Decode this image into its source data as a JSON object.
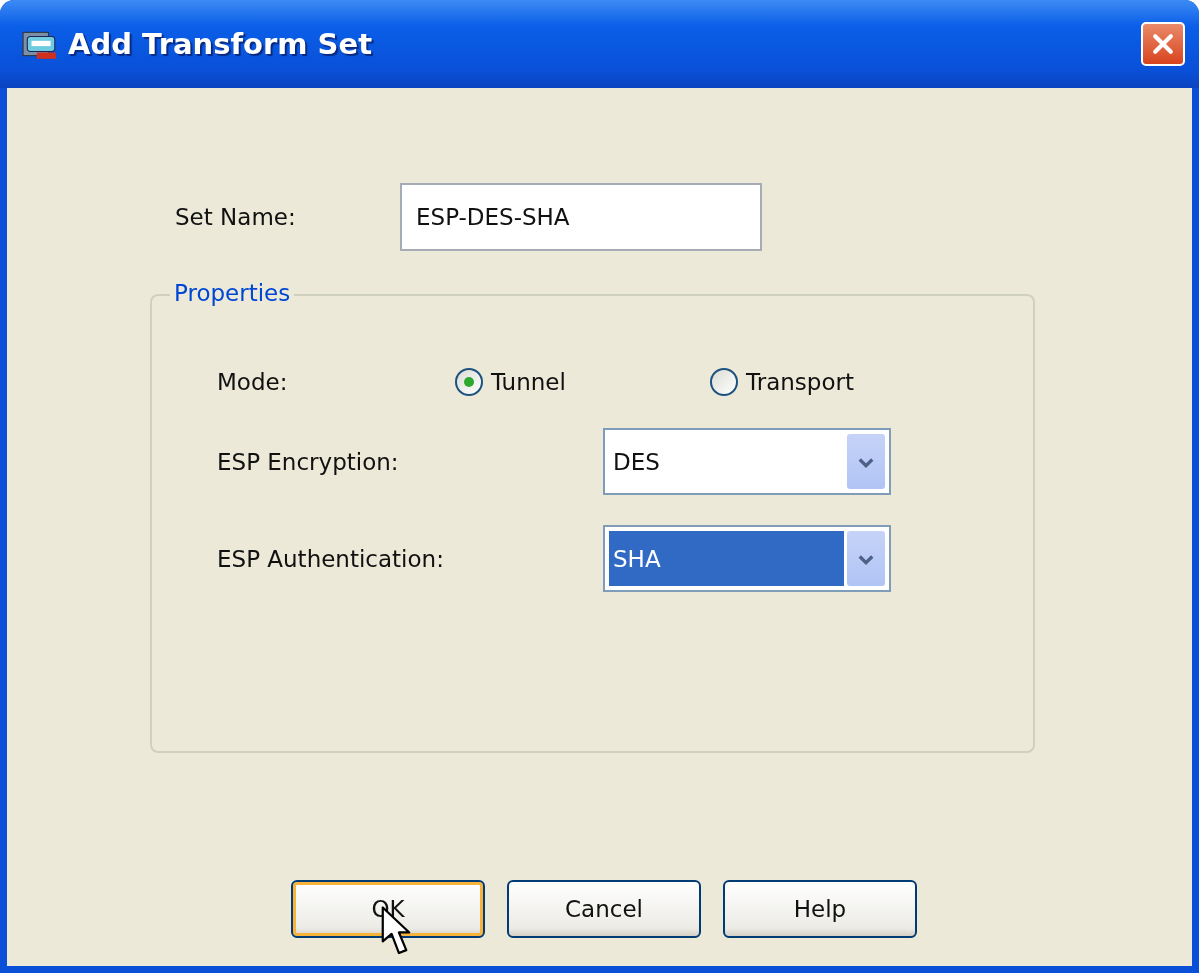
{
  "window": {
    "title": "Add Transform Set"
  },
  "set_name": {
    "label": "Set Name:",
    "value": "ESP-DES-SHA"
  },
  "properties": {
    "legend": "Properties",
    "mode": {
      "label": "Mode:",
      "options": [
        {
          "label": "Tunnel",
          "selected": true
        },
        {
          "label": "Transport",
          "selected": false
        }
      ]
    },
    "fields": [
      {
        "label": "ESP Encryption:",
        "value": "DES",
        "selected": false
      },
      {
        "label": "ESP Authentication:",
        "value": "SHA",
        "selected": true
      }
    ]
  },
  "buttons": [
    {
      "label": "OK",
      "default": true
    },
    {
      "label": "Cancel",
      "default": false
    },
    {
      "label": "Help",
      "default": false
    }
  ]
}
